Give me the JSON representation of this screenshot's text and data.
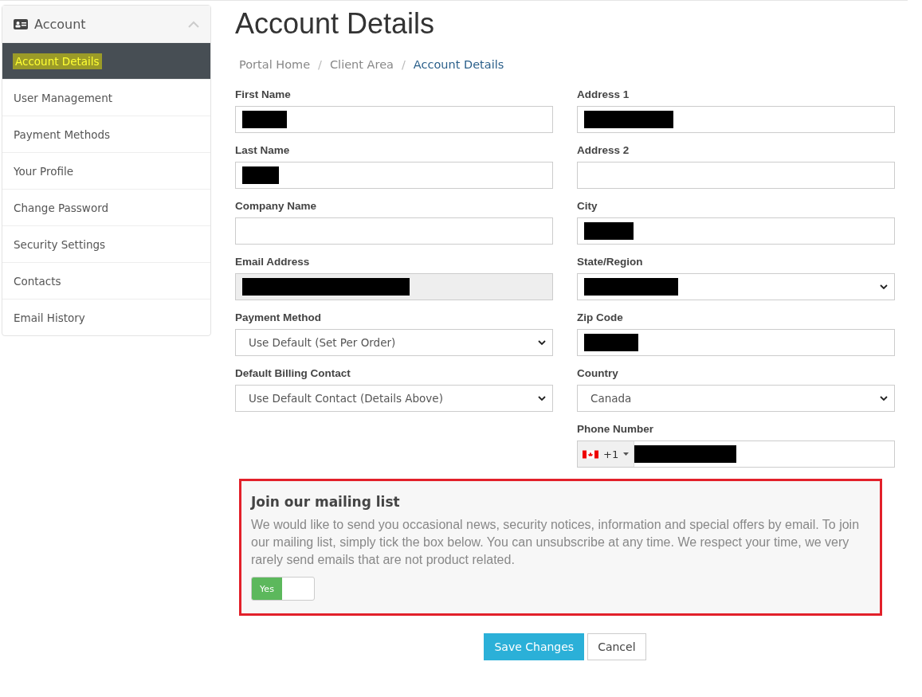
{
  "sidebar": {
    "title": "Account",
    "expanded": true,
    "items": [
      {
        "label": "Account Details",
        "selected": true,
        "highlighted": true
      },
      {
        "label": "User Management",
        "selected": false,
        "highlighted": false
      },
      {
        "label": "Payment Methods",
        "selected": false,
        "highlighted": false
      },
      {
        "label": "Your Profile",
        "selected": false,
        "highlighted": false
      },
      {
        "label": "Change Password",
        "selected": false,
        "highlighted": false
      },
      {
        "label": "Security Settings",
        "selected": false,
        "highlighted": false
      },
      {
        "label": "Contacts",
        "selected": false,
        "highlighted": false
      },
      {
        "label": "Email History",
        "selected": false,
        "highlighted": false
      }
    ]
  },
  "page_title": "Account Details",
  "breadcrumb_separator": "/",
  "breadcrumb": [
    {
      "label": "Portal Home",
      "selected": false
    },
    {
      "label": "Client Area",
      "selected": false
    },
    {
      "label": "Account Details",
      "selected": true
    }
  ],
  "left_fields": [
    {
      "label": "First Name",
      "kind": "text",
      "redacted": true,
      "disabled": false
    },
    {
      "label": "Last Name",
      "kind": "text",
      "redacted": true,
      "disabled": false
    },
    {
      "label": "Company Name",
      "kind": "text",
      "redacted": false,
      "disabled": false
    },
    {
      "label": "Email Address",
      "kind": "text",
      "redacted": true,
      "disabled": true
    },
    {
      "label": "Payment Method",
      "kind": "select",
      "value": "Use Default (Set Per Order)",
      "redacted": false,
      "disabled": false
    },
    {
      "label": "Default Billing Contact",
      "kind": "select",
      "value": "Use Default Contact (Details Above)",
      "redacted": false,
      "disabled": false
    }
  ],
  "right_fields": [
    {
      "label": "Address 1",
      "kind": "text",
      "redacted": true,
      "disabled": false
    },
    {
      "label": "Address 2",
      "kind": "text",
      "redacted": false,
      "disabled": false
    },
    {
      "label": "City",
      "kind": "text",
      "redacted": true,
      "disabled": false
    },
    {
      "label": "State/Region",
      "kind": "select",
      "redacted": true,
      "disabled": false
    },
    {
      "label": "Zip Code",
      "kind": "text",
      "redacted": true,
      "disabled": false
    },
    {
      "label": "Country",
      "kind": "select",
      "value": "Canada",
      "redacted": false,
      "disabled": false
    },
    {
      "label": "Phone Number",
      "kind": "phone",
      "dial_code": "+1",
      "redacted": true,
      "disabled": false
    }
  ],
  "mailing_list": {
    "title": "Join our mailing list",
    "outlined": true,
    "text": "We would like to send you occasional news, security notices, information and special offers by email. To join our mailing list, simply tick the box below. You can unsubscribe at any time. We respect your time, we very rarely send emails that are not product related.",
    "toggle": {
      "label": "Yes",
      "checked": true
    }
  },
  "buttons": [
    {
      "label": "Save Changes",
      "kind": "primary"
    },
    {
      "label": "Cancel",
      "kind": "secondary"
    }
  ]
}
